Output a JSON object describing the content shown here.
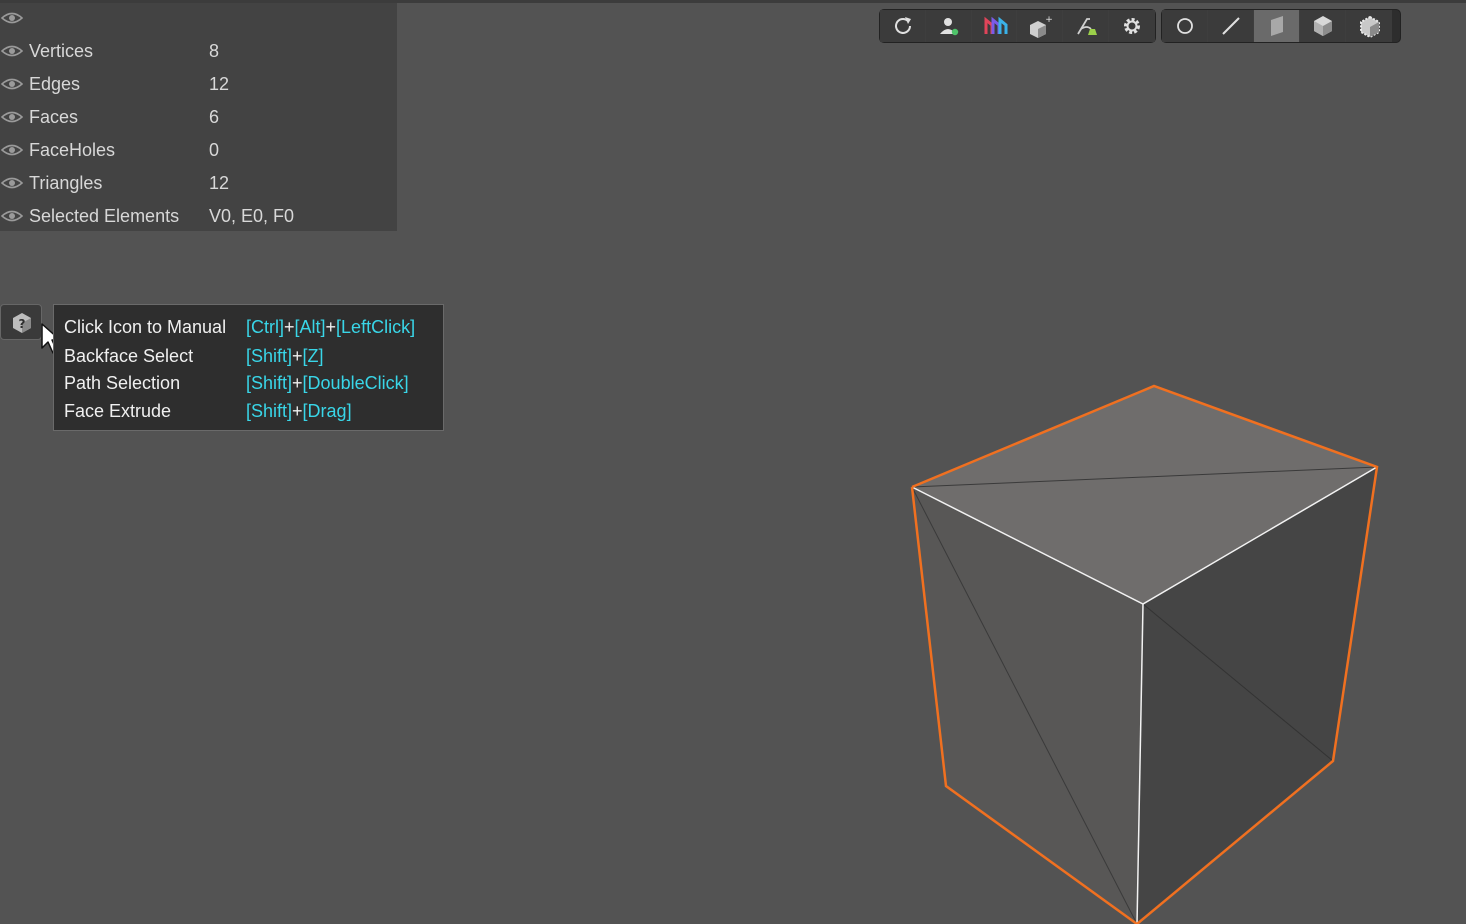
{
  "stats": [
    {
      "label": "",
      "value": ""
    },
    {
      "label": "Vertices",
      "value": "8"
    },
    {
      "label": "Edges",
      "value": "12"
    },
    {
      "label": "Faces",
      "value": "6"
    },
    {
      "label": "FaceHoles",
      "value": "0"
    },
    {
      "label": "Triangles",
      "value": "12"
    },
    {
      "label": "Selected Elements",
      "value": "V0, E0, F0"
    }
  ],
  "help": {
    "rows": [
      {
        "label": "Click Icon to Manual",
        "keys": [
          "[Ctrl]",
          "[Alt]",
          "[LeftClick]"
        ]
      },
      {
        "label": "Backface Select",
        "keys": [
          "[Shift]",
          "[Z]"
        ]
      },
      {
        "label": "Path Selection",
        "keys": [
          "[Shift]",
          "[DoubleClick]"
        ]
      },
      {
        "label": "Face Extrude",
        "keys": [
          "[Shift]",
          "[Drag]"
        ]
      }
    ],
    "separator": "+"
  },
  "toolbar": {
    "group1": [
      "refresh-icon",
      "user-icon",
      "logo-icon",
      "add-cube-icon",
      "sculpt-icon",
      "gear-icon"
    ],
    "group2": [
      "vertex-mode-icon",
      "edge-mode-icon",
      "face-mode-icon",
      "object-mode-icon",
      "element-mode-icon"
    ],
    "active": "face-mode-icon"
  },
  "colors": {
    "accent_key": "#39d6e8",
    "selection_outline": "#f07020",
    "background": "#535353"
  }
}
